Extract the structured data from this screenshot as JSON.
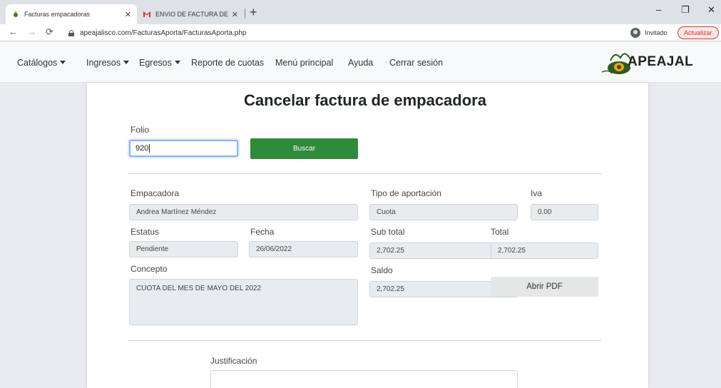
{
  "browser": {
    "tabs": [
      {
        "title": "Facturas empacadoras",
        "active": true
      },
      {
        "title": "ENVIO DE FACTURA DE ACOPIO",
        "active": false
      }
    ],
    "url": "apeajalisco.com/FacturasAporta/FacturasAporta.php",
    "profile_label": "Invitado",
    "update_label": "Actualizar",
    "accent_color": "#d93025"
  },
  "navbar": {
    "items": [
      {
        "label": "Catálogos",
        "dropdown": true
      },
      {
        "label": "Ingresos",
        "dropdown": true
      },
      {
        "label": "Egresos",
        "dropdown": true
      },
      {
        "label": "Reporte de cuotas",
        "dropdown": false
      },
      {
        "label": "Menú principal",
        "dropdown": false
      },
      {
        "label": "Ayuda",
        "dropdown": false
      },
      {
        "label": "Cerrar sesión",
        "dropdown": false
      }
    ],
    "brand": "APEAJAL"
  },
  "page": {
    "title": "Cancelar factura de empacadora",
    "folio": {
      "label": "Folio",
      "value": "920"
    },
    "search_button": "Buscar",
    "fields": {
      "empacadora": {
        "label": "Empacadora",
        "value": "Andrea Martínez Méndez"
      },
      "tipo_aportacion": {
        "label": "Tipo de aportación",
        "value": "Cuota"
      },
      "iva": {
        "label": "Iva",
        "value": "0.00"
      },
      "estatus": {
        "label": "Estatus",
        "value": "Pendiente"
      },
      "fecha": {
        "label": "Fecha",
        "value": "26/06/2022"
      },
      "sub_total": {
        "label": "Sub total",
        "value": "2,702.25"
      },
      "total": {
        "label": "Total",
        "value": "2,702.25"
      },
      "concepto": {
        "label": "Concepto",
        "value": "CUOTA DEL MES DE MAYO DEL 2022"
      },
      "saldo": {
        "label": "Saldo",
        "value": "2,702.25"
      }
    },
    "open_pdf_button": "Abrir PDF",
    "justificacion_label": "Justificación",
    "primary_color": "#2e8b3a"
  }
}
